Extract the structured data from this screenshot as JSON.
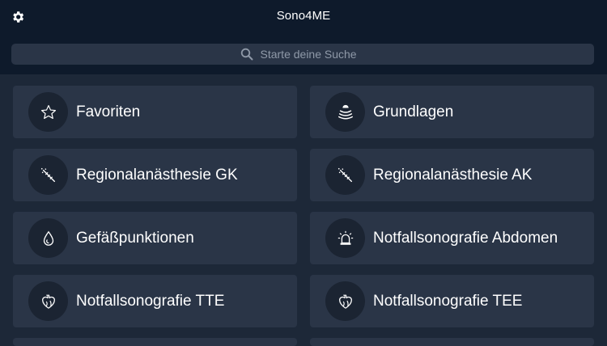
{
  "app": {
    "title": "Sono4ME"
  },
  "header": {
    "settings_icon": "gear-icon"
  },
  "search": {
    "placeholder": "Starte deine Suche",
    "value": "",
    "icon": "search-icon"
  },
  "categories": [
    {
      "label": "Favoriten",
      "icon": "star-icon"
    },
    {
      "label": "Grundlagen",
      "icon": "ultrasound-waves-icon"
    },
    {
      "label": "Regionalanästhesie GK",
      "icon": "needle-icon"
    },
    {
      "label": "Regionalanästhesie AK",
      "icon": "needle-icon"
    },
    {
      "label": "Gefäßpunktionen",
      "icon": "blood-drop-icon"
    },
    {
      "label": "Notfallsonografie Abdomen",
      "icon": "emergency-light-icon"
    },
    {
      "label": "Notfallsonografie TTE",
      "icon": "heart-icon"
    },
    {
      "label": "Notfallsonografie TEE",
      "icon": "heart-icon"
    }
  ],
  "colors": {
    "header_bg": "#0e1a2b",
    "page_bg": "#1d2838",
    "tile_bg": "#2a3547",
    "icon_circle_bg": "#1b2432",
    "text": "#ffffff",
    "placeholder": "#8f99a8"
  }
}
